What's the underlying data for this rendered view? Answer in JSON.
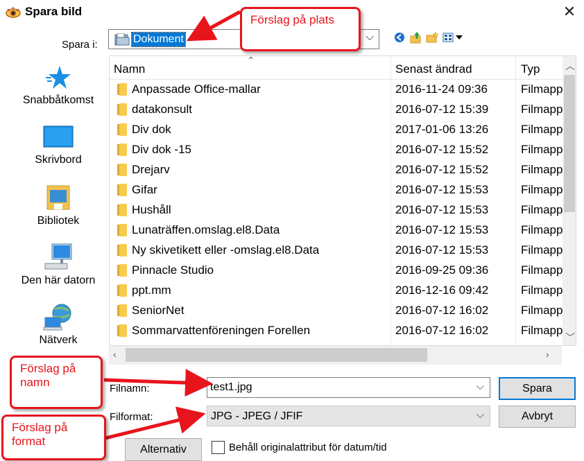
{
  "window": {
    "title": "Spara bild",
    "close_label": "✕"
  },
  "save_in": {
    "label": "Spara i:",
    "value": "Dokument",
    "caret": "⌵"
  },
  "toolbar": {
    "icons": [
      "back-icon",
      "up-folder-icon",
      "new-folder-icon",
      "view-menu-icon"
    ]
  },
  "places": [
    {
      "label": "Snabbåtkomst",
      "icon": "star-icon"
    },
    {
      "label": "Skrivbord",
      "icon": "desktop-icon"
    },
    {
      "label": "Bibliotek",
      "icon": "library-icon"
    },
    {
      "label": "Den här datorn",
      "icon": "computer-icon"
    },
    {
      "label": "Nätverk",
      "icon": "network-icon"
    }
  ],
  "file_list": {
    "columns": [
      "Namn",
      "Senast ändrad",
      "Typ"
    ],
    "rows": [
      {
        "name": "Anpassade Office-mallar",
        "modified": "2016-11-24 09:36",
        "type": "Filmapp"
      },
      {
        "name": "datakonsult",
        "modified": "2016-07-12 15:39",
        "type": "Filmapp"
      },
      {
        "name": "Div dok",
        "modified": "2017-01-06 13:26",
        "type": "Filmapp"
      },
      {
        "name": "Div dok -15",
        "modified": "2016-07-12 15:52",
        "type": "Filmapp"
      },
      {
        "name": "Drejarv",
        "modified": "2016-07-12 15:52",
        "type": "Filmapp"
      },
      {
        "name": "Gifar",
        "modified": "2016-07-12 15:53",
        "type": "Filmapp"
      },
      {
        "name": "Hushåll",
        "modified": "2016-07-12 15:53",
        "type": "Filmapp"
      },
      {
        "name": "Lunaträffen.omslag.el8.Data",
        "modified": "2016-07-12 15:53",
        "type": "Filmapp"
      },
      {
        "name": "Ny skivetikett eller -omslag.el8.Data",
        "modified": "2016-07-12 15:53",
        "type": "Filmapp"
      },
      {
        "name": "Pinnacle Studio",
        "modified": "2016-09-25 09:36",
        "type": "Filmapp"
      },
      {
        "name": "ppt.mm",
        "modified": "2016-12-16 09:42",
        "type": "Filmapp"
      },
      {
        "name": "SeniorNet",
        "modified": "2016-07-12 16:02",
        "type": "Filmapp"
      },
      {
        "name": "Sommarvattenföreningen Forellen",
        "modified": "2016-07-12 16:02",
        "type": "Filmapp"
      }
    ]
  },
  "form": {
    "filename_label": "Filnamn:",
    "filename_value": "test1.jpg",
    "format_label": "Filformat:",
    "format_value": "JPG - JPEG / JFIF",
    "save_button": "Spara",
    "cancel_button": "Avbryt",
    "options_button": "Alternativ",
    "keep_attr_label": "Behåll originalattribut för datum/tid",
    "keep_attr_checked": false
  },
  "annotations": {
    "location": "Förslag på plats",
    "name": "Förslag på namn",
    "format": "Förslag på format",
    "color": "#e8141c"
  }
}
